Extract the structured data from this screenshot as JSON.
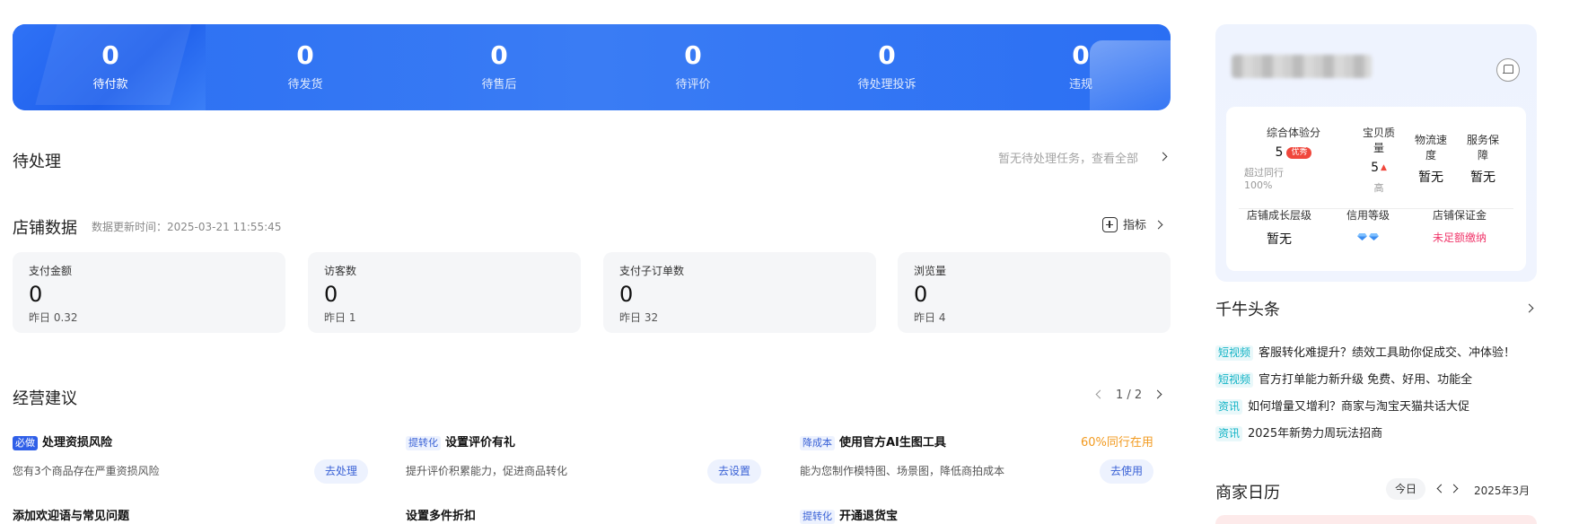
{
  "order_stats": [
    {
      "count": "0",
      "label": "待付款"
    },
    {
      "count": "0",
      "label": "待发货"
    },
    {
      "count": "0",
      "label": "待售后"
    },
    {
      "count": "0",
      "label": "待评价"
    },
    {
      "count": "0",
      "label": "待处理投诉"
    },
    {
      "count": "0",
      "label": "违规"
    }
  ],
  "todo": {
    "title": "待处理",
    "empty_link": "暂无待处理任务，查看全部"
  },
  "shop_data": {
    "title": "店铺数据",
    "update_time": "数据更新时间：2025-03-21 11:55:45",
    "metrics_button": "指标",
    "cards": [
      {
        "label": "支付金额",
        "value": "0",
        "yesterday": "昨日 0.32"
      },
      {
        "label": "访客数",
        "value": "0",
        "yesterday": "昨日 1"
      },
      {
        "label": "支付子订单数",
        "value": "0",
        "yesterday": "昨日 32"
      },
      {
        "label": "浏览量",
        "value": "0",
        "yesterday": "昨日 4"
      }
    ]
  },
  "suggestions": {
    "title": "经营建议",
    "pager": "1 / 2",
    "items": [
      {
        "tag": "必做",
        "title": "处理资损风险",
        "desc": "您有3个商品存在严重资损风险",
        "button": "去处理"
      },
      {
        "tag": "提转化",
        "title": "设置评价有礼",
        "desc": "提升评价积累能力，促进商品转化",
        "button": "去设置"
      },
      {
        "tag": "降成本",
        "title": "使用官方AI生图工具",
        "desc": "能为您制作模特图、场景图，降低商拍成本",
        "button": "去使用",
        "peer": "60%同行在用"
      },
      {
        "tag": "",
        "title": "添加欢迎语与常见问题"
      },
      {
        "tag": "",
        "title": "设置多件折扣"
      },
      {
        "tag": "提转化",
        "title": "开通退货宝"
      }
    ]
  },
  "shop_panel": {
    "experience": {
      "label": "综合体验分",
      "value": "5",
      "badge": "优秀",
      "peer": "超过同行",
      "peer_pct": "100%"
    },
    "quality": {
      "label": "宝贝质量",
      "value": "5",
      "level": "高"
    },
    "logistics": {
      "label": "物流速度",
      "value": "暂无"
    },
    "service": {
      "label": "服务保障",
      "value": "暂无"
    },
    "growth": {
      "label": "店铺成长层级",
      "value": "暂无"
    },
    "credit": {
      "label": "信用等级",
      "gems": 2
    },
    "deposit": {
      "label": "店铺保证金",
      "value": "未足额缴纳"
    }
  },
  "news": {
    "title": "千牛头条",
    "items": [
      {
        "tag": "短视频",
        "text": "客服转化难提升？绩效工具助你促成交、冲体验！"
      },
      {
        "tag": "短视频",
        "text": "官方打单能力新升级 免费、好用、功能全"
      },
      {
        "tag": "资讯",
        "text": "如何增量又增利？商家与淘宝天猫共话大促"
      },
      {
        "tag": "资讯",
        "text": "2025年新势力周玩法招商"
      }
    ]
  },
  "calendar": {
    "title": "商家日历",
    "today_button": "今日",
    "month": "2025年3月"
  },
  "colors": {
    "banner": "#2b6ff3",
    "accent_blue": "#3a62d6",
    "badge_red": "#f0473c",
    "warning_orange": "#f29a1f",
    "news_tag": "#12b3c5"
  }
}
